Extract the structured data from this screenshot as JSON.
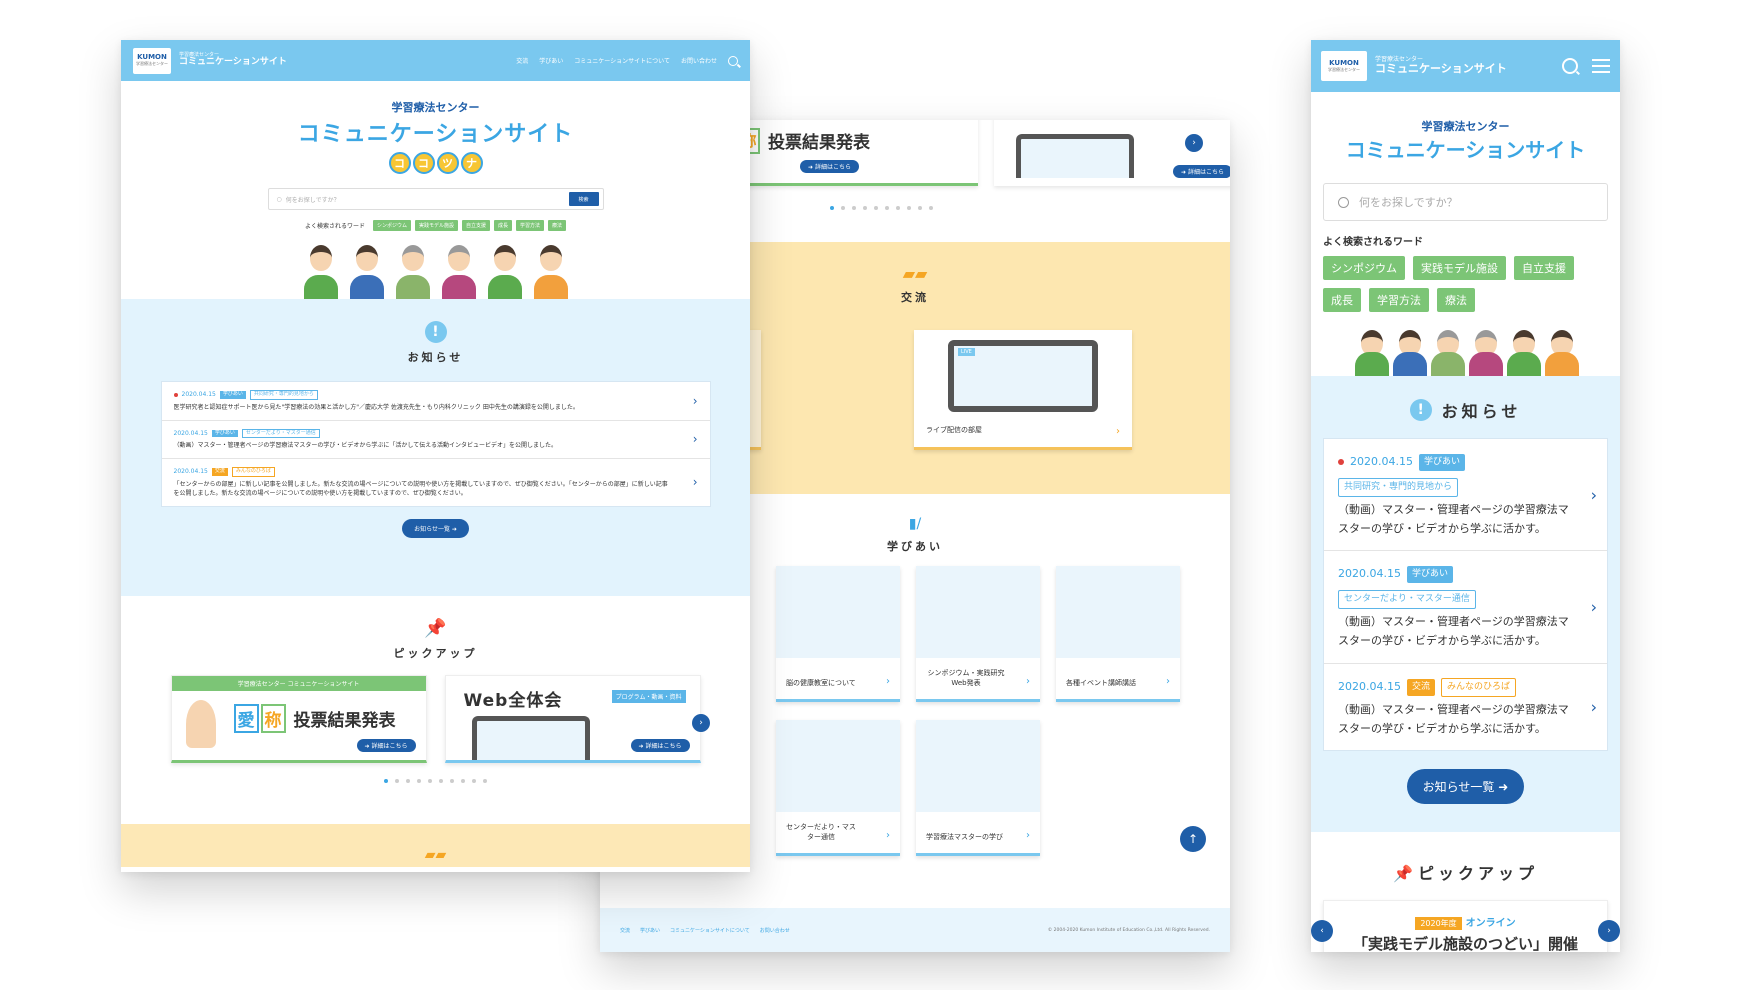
{
  "brand": {
    "logo": "KUMON",
    "logo_sub": "学習療法センター",
    "site_sub": "学習療法センター",
    "site_name": "コミュニケーションサイト"
  },
  "nav": [
    "交流",
    "学びあい",
    "コミュニケーションサイトについて",
    "お問い合わせ"
  ],
  "hero": {
    "subtitle": "学習療法センター",
    "title": "コミュニケーションサイト",
    "nickname": [
      "コ",
      "コ",
      "ツ",
      "ナ"
    ]
  },
  "search": {
    "placeholder": "何をお探しですか？",
    "button": "検索",
    "keywords_label": "よく検索されるワード",
    "keywords": [
      "シンポジウム",
      "実践モデル施設",
      "自立支援",
      "成長",
      "学習方法",
      "療法"
    ]
  },
  "notice": {
    "title": "お知らせ",
    "items": [
      {
        "date": "2020.04.15",
        "tag": "学びあい",
        "tag2": "共同研究・専門的見地から",
        "text": "医学研究者と認知症サポート医から見た\"学習療法の効果と活かし方\"／慶応大学 佐渡充先生・もり内科クリニック 田中先生の講演録を公開しました。"
      },
      {
        "date": "2020.04.15",
        "tag": "学びあい",
        "tag2": "センターだより・マスター通信",
        "text": "（動画）マスター・管理者ページの学習療法マスターの学び・ビデオから学ぶに「活かして伝える活動インタビュービデオ」を公開しました。"
      },
      {
        "date": "2020.04.15",
        "tag": "交流",
        "tag2": "みんなのひろば",
        "text": "「センターからの部屋」に新しい記事を公開しました。新たな交流の場ページについての説明や使い方を掲載していますので、ぜひ御覧ください。「センターからの部屋」に新しい記事を公開しました。新たな交流の場ページについての説明や使い方を掲載していますので、ぜひ御覧ください。"
      }
    ],
    "more": "お知らせ一覧"
  },
  "pickup": {
    "title": "ピックアップ",
    "card1_strip": "学習療法センター コミュニケーションサイト",
    "card1_kanji": [
      "愛",
      "称"
    ],
    "card1_title": "投票結果発表",
    "card2_title": "Web全体会",
    "card2_tag": "プログラム・動画・資料",
    "detail": "詳細はこちら"
  },
  "koryu": {
    "title": "交流",
    "card2_label": "ライブ配信の部屋",
    "live": "LIVE"
  },
  "manabi": {
    "title": "学びあい",
    "cards": [
      "脳の健康教室について",
      "シンポジウム・実践研究Web発表",
      "各種イベント講師講話",
      "センターだより・マスター通信",
      "学習療法マスターの学び"
    ]
  },
  "footer": {
    "links": [
      "交流",
      "学びあい",
      "コミュニケーションサイトについて",
      "お問い合わせ"
    ],
    "copyright": "© 2004-2020 Kumon Institute of Education Co.,Ltd. All Rights Reserved."
  },
  "mobile": {
    "notice_items": [
      {
        "date": "2020.04.15",
        "tag": "学びあい",
        "tag2": "共同研究・専門的見地から",
        "text": "（動画）マスター・管理者ページの学習療法マスターの学び・ビデオから学ぶに活かす。"
      },
      {
        "date": "2020.04.15",
        "tag": "学びあい",
        "tag2": "センターだより・マスター通信",
        "text": "（動画）マスター・管理者ページの学習療法マスターの学び・ビデオから学ぶに活かす。"
      },
      {
        "date": "2020.04.15",
        "tag": "交流",
        "tag2": "みんなのひろば",
        "text": "（動画）マスター・管理者ページの学習療法マスターの学び・ビデオから学ぶに活かす。"
      }
    ],
    "pick_year": "2020年度",
    "pick_online": "オンライン",
    "pick_title": "「実践モデル施設のつどい」開催"
  },
  "colors": {
    "header": "#7ac8ef",
    "accent": "#3ba6e3",
    "navy": "#1f5ea8",
    "green": "#7cc576",
    "notice_bg": "#e2f3fd",
    "yellow_bg": "#fde7b0"
  }
}
